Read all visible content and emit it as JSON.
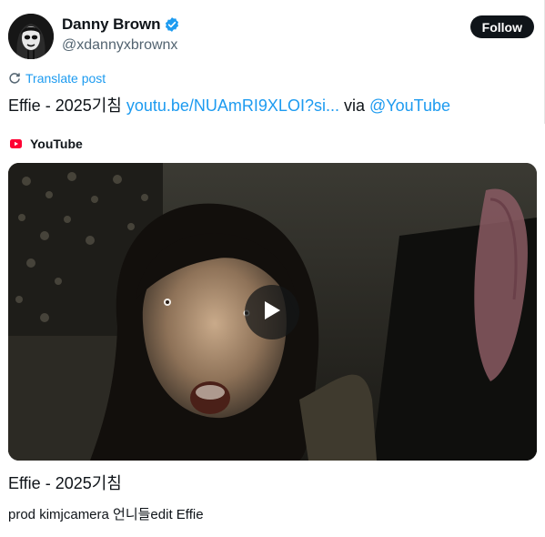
{
  "author": {
    "display_name": "Danny Brown",
    "handle": "@xdannyxbrownx",
    "verified": true
  },
  "follow_label": "Follow",
  "translate_label": "Translate post",
  "post": {
    "text_prefix": "Effie - 2025기침 ",
    "link_text": "youtu.be/NUAmRI9XLOI?si...",
    "text_middle": " via ",
    "mention": "@YouTube"
  },
  "card": {
    "source_label": "YouTube",
    "title": "Effie - 2025기침",
    "description": "prod kimjcamera 언니들edit Effie"
  },
  "icons": {
    "verified": "verified-badge-icon",
    "translate": "translate-icon",
    "source": "youtube-icon",
    "play": "play-icon"
  },
  "colors": {
    "accent": "#1d9bf0",
    "text": "#0f1419",
    "secondary_text": "#536471",
    "follow_button_bg": "#0f1419",
    "youtube_red": "#ff0033"
  }
}
